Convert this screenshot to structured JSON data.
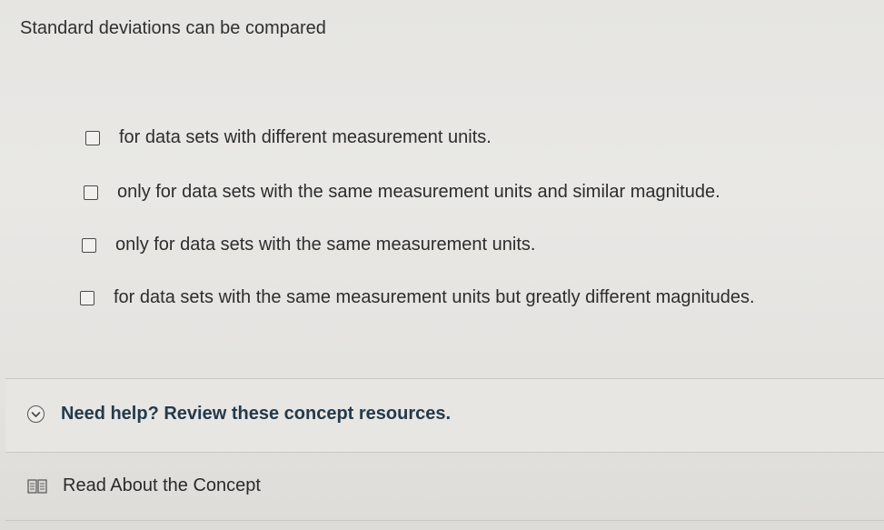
{
  "question": {
    "text": "Standard deviations can be compared"
  },
  "options": [
    {
      "label": "for data sets with different measurement units.",
      "checked": false
    },
    {
      "label": "only for data sets with the same measurement units and similar magnitude.",
      "checked": false
    },
    {
      "label": "only for data sets with the same measurement units.",
      "checked": false
    },
    {
      "label": "for data sets with the same measurement units but greatly different magnitudes.",
      "checked": false
    }
  ],
  "help": {
    "title": "Need help? Review these concept resources.",
    "toggle_icon": "chevron-down-icon",
    "resource": {
      "label": "Read About the Concept",
      "icon": "book-icon"
    }
  },
  "colors": {
    "help_title": "#233a4a",
    "background": "#e7e6e3"
  }
}
